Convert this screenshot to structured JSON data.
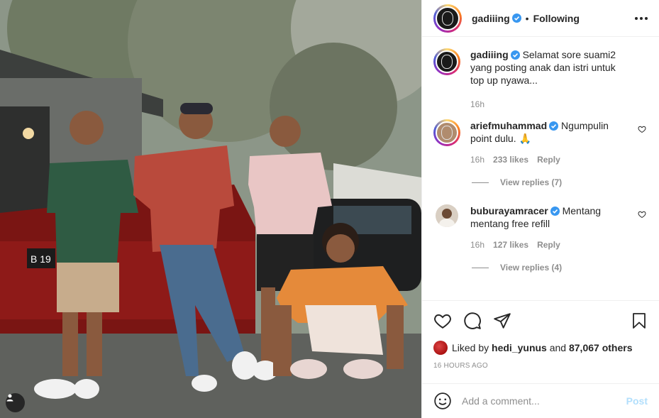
{
  "post": {
    "author": "gadiiing",
    "follow_status": "Following",
    "dot": "•",
    "caption": "Selamat sore suami2 yang posting anak dan istri untuk top up nyawa...",
    "caption_time": "16h",
    "photo_plate": "B 19"
  },
  "comments": [
    {
      "username": "ariefmuhammad",
      "text": "Ngumpulin point dulu. 🙏",
      "time": "16h",
      "likes": "233 likes",
      "reply_label": "Reply",
      "view_replies": "View replies (7)"
    },
    {
      "username": "buburayamracer",
      "text": "Mentang mentang free refill",
      "time": "16h",
      "likes": "127 likes",
      "reply_label": "Reply",
      "view_replies": "View replies (4)"
    }
  ],
  "likes_summary": {
    "prefix": "Liked by",
    "user": "hedi_yunus",
    "middle": "and",
    "others": "87,067 others"
  },
  "timestamp": "16 HOURS AGO",
  "add_comment": {
    "placeholder": "Add a comment...",
    "post_label": "Post"
  },
  "colors": {
    "verified": "#3897f0",
    "muted_text": "#8e8e8e",
    "post_button_disabled": "#b2dffc"
  }
}
